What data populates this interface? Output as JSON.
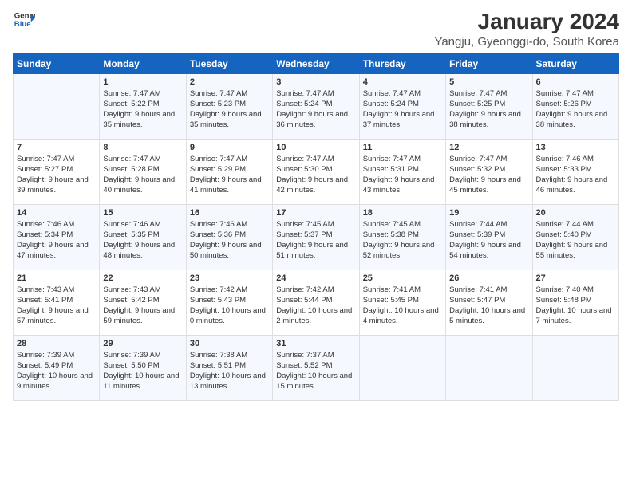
{
  "header": {
    "logo_line1": "General",
    "logo_line2": "Blue",
    "title": "January 2024",
    "subtitle": "Yangju, Gyeonggi-do, South Korea"
  },
  "days_of_week": [
    "Sunday",
    "Monday",
    "Tuesday",
    "Wednesday",
    "Thursday",
    "Friday",
    "Saturday"
  ],
  "weeks": [
    [
      {
        "day": "",
        "sunrise": "",
        "sunset": "",
        "daylight": ""
      },
      {
        "day": "1",
        "sunrise": "Sunrise: 7:47 AM",
        "sunset": "Sunset: 5:22 PM",
        "daylight": "Daylight: 9 hours and 35 minutes."
      },
      {
        "day": "2",
        "sunrise": "Sunrise: 7:47 AM",
        "sunset": "Sunset: 5:23 PM",
        "daylight": "Daylight: 9 hours and 35 minutes."
      },
      {
        "day": "3",
        "sunrise": "Sunrise: 7:47 AM",
        "sunset": "Sunset: 5:24 PM",
        "daylight": "Daylight: 9 hours and 36 minutes."
      },
      {
        "day": "4",
        "sunrise": "Sunrise: 7:47 AM",
        "sunset": "Sunset: 5:24 PM",
        "daylight": "Daylight: 9 hours and 37 minutes."
      },
      {
        "day": "5",
        "sunrise": "Sunrise: 7:47 AM",
        "sunset": "Sunset: 5:25 PM",
        "daylight": "Daylight: 9 hours and 38 minutes."
      },
      {
        "day": "6",
        "sunrise": "Sunrise: 7:47 AM",
        "sunset": "Sunset: 5:26 PM",
        "daylight": "Daylight: 9 hours and 38 minutes."
      }
    ],
    [
      {
        "day": "7",
        "sunrise": "Sunrise: 7:47 AM",
        "sunset": "Sunset: 5:27 PM",
        "daylight": "Daylight: 9 hours and 39 minutes."
      },
      {
        "day": "8",
        "sunrise": "Sunrise: 7:47 AM",
        "sunset": "Sunset: 5:28 PM",
        "daylight": "Daylight: 9 hours and 40 minutes."
      },
      {
        "day": "9",
        "sunrise": "Sunrise: 7:47 AM",
        "sunset": "Sunset: 5:29 PM",
        "daylight": "Daylight: 9 hours and 41 minutes."
      },
      {
        "day": "10",
        "sunrise": "Sunrise: 7:47 AM",
        "sunset": "Sunset: 5:30 PM",
        "daylight": "Daylight: 9 hours and 42 minutes."
      },
      {
        "day": "11",
        "sunrise": "Sunrise: 7:47 AM",
        "sunset": "Sunset: 5:31 PM",
        "daylight": "Daylight: 9 hours and 43 minutes."
      },
      {
        "day": "12",
        "sunrise": "Sunrise: 7:47 AM",
        "sunset": "Sunset: 5:32 PM",
        "daylight": "Daylight: 9 hours and 45 minutes."
      },
      {
        "day": "13",
        "sunrise": "Sunrise: 7:46 AM",
        "sunset": "Sunset: 5:33 PM",
        "daylight": "Daylight: 9 hours and 46 minutes."
      }
    ],
    [
      {
        "day": "14",
        "sunrise": "Sunrise: 7:46 AM",
        "sunset": "Sunset: 5:34 PM",
        "daylight": "Daylight: 9 hours and 47 minutes."
      },
      {
        "day": "15",
        "sunrise": "Sunrise: 7:46 AM",
        "sunset": "Sunset: 5:35 PM",
        "daylight": "Daylight: 9 hours and 48 minutes."
      },
      {
        "day": "16",
        "sunrise": "Sunrise: 7:46 AM",
        "sunset": "Sunset: 5:36 PM",
        "daylight": "Daylight: 9 hours and 50 minutes."
      },
      {
        "day": "17",
        "sunrise": "Sunrise: 7:45 AM",
        "sunset": "Sunset: 5:37 PM",
        "daylight": "Daylight: 9 hours and 51 minutes."
      },
      {
        "day": "18",
        "sunrise": "Sunrise: 7:45 AM",
        "sunset": "Sunset: 5:38 PM",
        "daylight": "Daylight: 9 hours and 52 minutes."
      },
      {
        "day": "19",
        "sunrise": "Sunrise: 7:44 AM",
        "sunset": "Sunset: 5:39 PM",
        "daylight": "Daylight: 9 hours and 54 minutes."
      },
      {
        "day": "20",
        "sunrise": "Sunrise: 7:44 AM",
        "sunset": "Sunset: 5:40 PM",
        "daylight": "Daylight: 9 hours and 55 minutes."
      }
    ],
    [
      {
        "day": "21",
        "sunrise": "Sunrise: 7:43 AM",
        "sunset": "Sunset: 5:41 PM",
        "daylight": "Daylight: 9 hours and 57 minutes."
      },
      {
        "day": "22",
        "sunrise": "Sunrise: 7:43 AM",
        "sunset": "Sunset: 5:42 PM",
        "daylight": "Daylight: 9 hours and 59 minutes."
      },
      {
        "day": "23",
        "sunrise": "Sunrise: 7:42 AM",
        "sunset": "Sunset: 5:43 PM",
        "daylight": "Daylight: 10 hours and 0 minutes."
      },
      {
        "day": "24",
        "sunrise": "Sunrise: 7:42 AM",
        "sunset": "Sunset: 5:44 PM",
        "daylight": "Daylight: 10 hours and 2 minutes."
      },
      {
        "day": "25",
        "sunrise": "Sunrise: 7:41 AM",
        "sunset": "Sunset: 5:45 PM",
        "daylight": "Daylight: 10 hours and 4 minutes."
      },
      {
        "day": "26",
        "sunrise": "Sunrise: 7:41 AM",
        "sunset": "Sunset: 5:47 PM",
        "daylight": "Daylight: 10 hours and 5 minutes."
      },
      {
        "day": "27",
        "sunrise": "Sunrise: 7:40 AM",
        "sunset": "Sunset: 5:48 PM",
        "daylight": "Daylight: 10 hours and 7 minutes."
      }
    ],
    [
      {
        "day": "28",
        "sunrise": "Sunrise: 7:39 AM",
        "sunset": "Sunset: 5:49 PM",
        "daylight": "Daylight: 10 hours and 9 minutes."
      },
      {
        "day": "29",
        "sunrise": "Sunrise: 7:39 AM",
        "sunset": "Sunset: 5:50 PM",
        "daylight": "Daylight: 10 hours and 11 minutes."
      },
      {
        "day": "30",
        "sunrise": "Sunrise: 7:38 AM",
        "sunset": "Sunset: 5:51 PM",
        "daylight": "Daylight: 10 hours and 13 minutes."
      },
      {
        "day": "31",
        "sunrise": "Sunrise: 7:37 AM",
        "sunset": "Sunset: 5:52 PM",
        "daylight": "Daylight: 10 hours and 15 minutes."
      },
      {
        "day": "",
        "sunrise": "",
        "sunset": "",
        "daylight": ""
      },
      {
        "day": "",
        "sunrise": "",
        "sunset": "",
        "daylight": ""
      },
      {
        "day": "",
        "sunrise": "",
        "sunset": "",
        "daylight": ""
      }
    ]
  ]
}
